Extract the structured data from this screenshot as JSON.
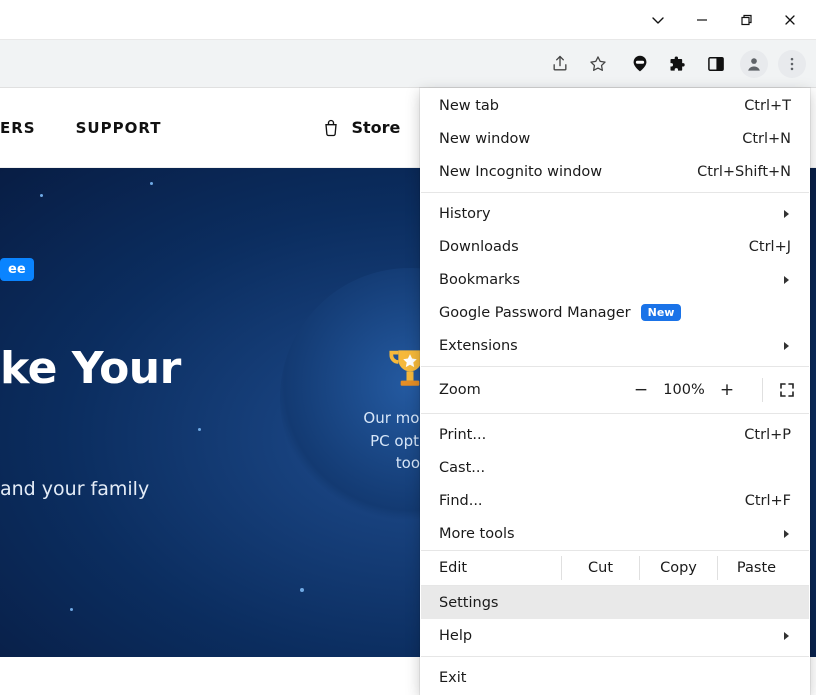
{
  "site": {
    "nav_partial_1": "ERS",
    "nav_support": "SUPPORT",
    "store": "Store"
  },
  "hero": {
    "pill": "ee",
    "title": "ke Your",
    "subtitle": "and your family",
    "trophy_line1": "Our most po",
    "trophy_line2": "PC optimiz",
    "trophy_line3": "tool"
  },
  "menu": {
    "new_tab": {
      "label": "New tab",
      "accel": "Ctrl+T"
    },
    "new_window": {
      "label": "New window",
      "accel": "Ctrl+N"
    },
    "new_incognito": {
      "label": "New Incognito window",
      "accel": "Ctrl+Shift+N"
    },
    "history": {
      "label": "History"
    },
    "downloads": {
      "label": "Downloads",
      "accel": "Ctrl+J"
    },
    "bookmarks": {
      "label": "Bookmarks"
    },
    "gpm": {
      "label": "Google Password Manager",
      "badge": "New"
    },
    "extensions": {
      "label": "Extensions"
    },
    "zoom": {
      "label": "Zoom",
      "minus": "−",
      "pct": "100%",
      "plus": "+"
    },
    "print": {
      "label": "Print...",
      "accel": "Ctrl+P"
    },
    "cast": {
      "label": "Cast..."
    },
    "find": {
      "label": "Find...",
      "accel": "Ctrl+F"
    },
    "more_tools": {
      "label": "More tools"
    },
    "edit": {
      "label": "Edit",
      "cut": "Cut",
      "copy": "Copy",
      "paste": "Paste"
    },
    "settings": {
      "label": "Settings"
    },
    "help": {
      "label": "Help"
    },
    "exit": {
      "label": "Exit"
    }
  }
}
